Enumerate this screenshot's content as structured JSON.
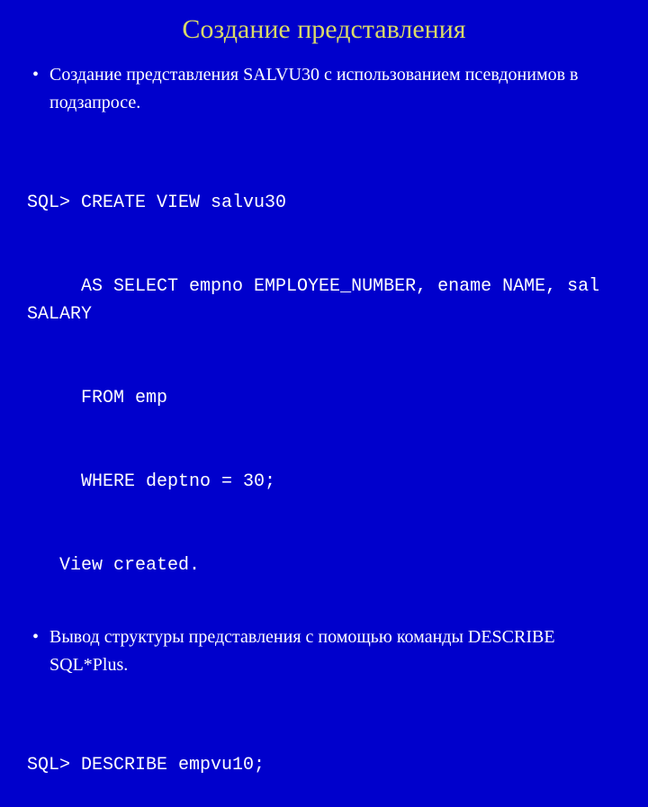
{
  "title": "Создание представления",
  "bullets": [
    "Создание представления SALVU30 с использованием псевдонимов в подзапросе.",
    "Вывод структуры представления с помощью команды DESCRIBE SQL*Plus."
  ],
  "code1": {
    "prompt": "SQL> CREATE VIEW salvu30",
    "line2": "     AS SELECT empno EMPLOYEE_NUMBER, ename NAME, sal SALARY",
    "line3": "     FROM emp",
    "line4": "     WHERE deptno = 30;",
    "result": "   View created."
  },
  "code2": {
    "line1": "SQL> DESCRIBE empvu10;"
  }
}
